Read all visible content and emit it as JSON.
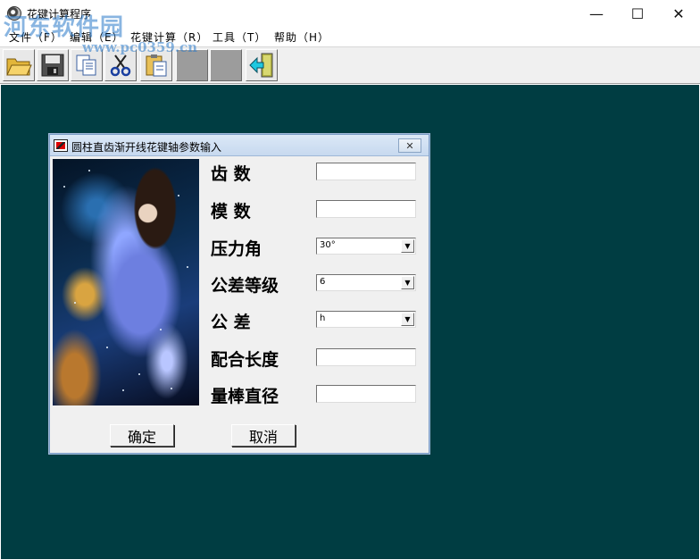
{
  "window": {
    "title": "花键计算程序",
    "minimize_glyph": "—",
    "maximize_glyph": "☐",
    "close_glyph": "✕"
  },
  "watermark": {
    "brand": "河东软件园",
    "url": "www.pc0359.cn"
  },
  "menu": [
    {
      "label": "文件（F）"
    },
    {
      "label": "编辑（E）"
    },
    {
      "label": "花键计算（R）"
    },
    {
      "label": "工具（T）"
    },
    {
      "label": "帮助（H）"
    }
  ],
  "toolbar": {
    "icons": [
      "open-folder-icon",
      "save-disk-icon",
      "copy-icon",
      "cut-scissors-icon",
      "paste-icon",
      "disabled-icon",
      "disabled-icon",
      "exit-door-icon"
    ]
  },
  "dialog": {
    "title": "圆柱直齿渐开线花键轴参数输入",
    "close_glyph": "✕",
    "fields": [
      {
        "label": "齿    数",
        "type": "text",
        "value": ""
      },
      {
        "label": "模    数",
        "type": "text",
        "value": ""
      },
      {
        "label": "压力角",
        "type": "select",
        "value": "30°"
      },
      {
        "label": "公差等级",
        "type": "select",
        "value": "6"
      },
      {
        "label": "公    差",
        "type": "select",
        "value": "h"
      },
      {
        "label": "配合长度",
        "type": "text",
        "value": ""
      },
      {
        "label": "量棒直径",
        "type": "text",
        "value": ""
      }
    ],
    "ok_label": "确定",
    "cancel_label": "取消"
  },
  "colors": {
    "workspace": "#003d42",
    "dialog_bg": "#f0f0f0",
    "title_gradient": "#c7d9ef"
  }
}
